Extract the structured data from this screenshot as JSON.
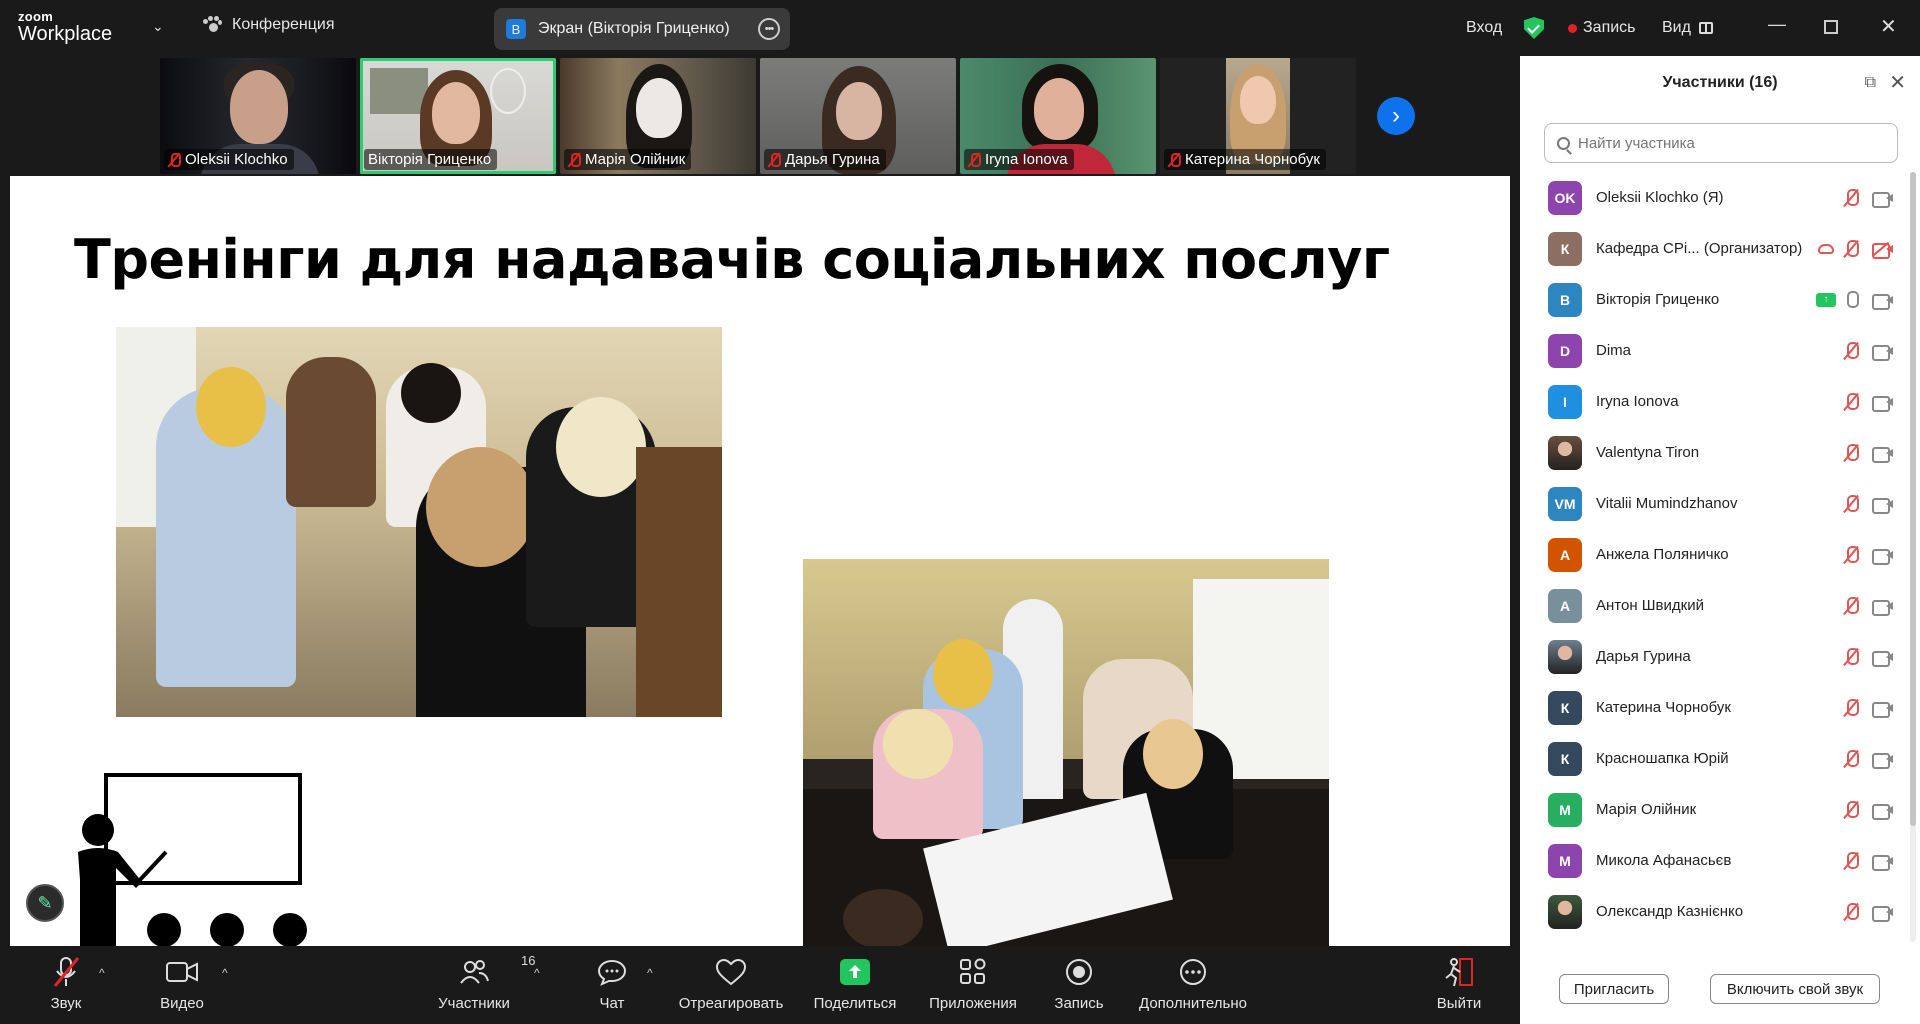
{
  "app": {
    "logo_top": "zoom",
    "logo_bottom": "Workplace",
    "meeting_label": "Конференция"
  },
  "screen_share": {
    "badge": "В",
    "label": "Экран (Вікторія Гриценко)"
  },
  "topright": {
    "signin": "Вход",
    "record": "Запись",
    "view": "Вид"
  },
  "colors": {
    "accent": "#0e72ed",
    "active_speaker": "#2ecc71",
    "muted": "#e02424"
  },
  "thumbnails": [
    {
      "name": "Oleksii Klochko"
    },
    {
      "name": "Вікторія Гриценко"
    },
    {
      "name": "Марія Олійник"
    },
    {
      "name": "Дарья Гурина"
    },
    {
      "name": "Iryna Ionova"
    },
    {
      "name": "Катерина Чорнобук"
    }
  ],
  "slide": {
    "title": "Тренінги для надавачів соціальних послуг"
  },
  "toolbar": {
    "audio": "Звук",
    "video": "Видео",
    "participants": "Участники",
    "participants_count": "16",
    "chat": "Чат",
    "react": "Отреагировать",
    "share": "Поделиться",
    "apps": "Приложения",
    "record": "Запись",
    "more": "Дополнительно",
    "leave": "Выйти"
  },
  "panel": {
    "title": "Участники (16)",
    "search_placeholder": "Найти участника",
    "invite": "Пригласить",
    "unmute_self": "Включить свой звук",
    "participants": [
      {
        "initials": "OK",
        "name": "Oleksii Klochko (Я)",
        "color": "#8e44ad"
      },
      {
        "initials": "К",
        "name": "Кафедра СРі... (Организатор)",
        "color": "#8d6e63"
      },
      {
        "initials": "В",
        "name": "Вікторія Гриценко",
        "color": "#2e86c1"
      },
      {
        "initials": "D",
        "name": "Dima",
        "color": "#8e44ad"
      },
      {
        "initials": "I",
        "name": "Iryna Ionova",
        "color": "#1f8fe0"
      },
      {
        "initials": "",
        "name": "Valentyna Tiron",
        "color": "#6b4f3f"
      },
      {
        "initials": "VM",
        "name": "Vitalii Mumindzhanov",
        "color": "#2e86c1"
      },
      {
        "initials": "А",
        "name": "Анжела Поляничко",
        "color": "#d35400"
      },
      {
        "initials": "А",
        "name": "Антон Швидкий",
        "color": "#78909c"
      },
      {
        "initials": "",
        "name": "Дарья Гурина",
        "color": "#6d7f8f"
      },
      {
        "initials": "К",
        "name": "Катерина Чорнобук",
        "color": "#34495e"
      },
      {
        "initials": "К",
        "name": "Красношапка Юрій",
        "color": "#34495e"
      },
      {
        "initials": "М",
        "name": "Марія Олійник",
        "color": "#27ae60"
      },
      {
        "initials": "М",
        "name": "Микола Афанасьєв",
        "color": "#8e44ad"
      },
      {
        "initials": "",
        "name": "Олександр Казнієнко",
        "color": "#3d5a3d"
      }
    ]
  }
}
